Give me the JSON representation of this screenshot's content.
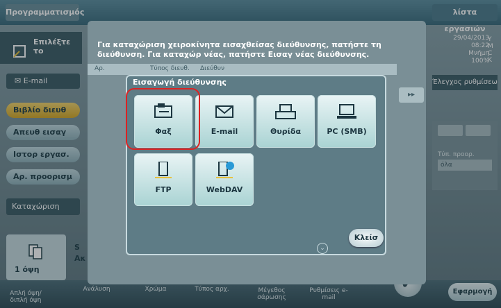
{
  "header": {
    "programs_tab": "Προγραμματισμός",
    "job_list_tab": "λίστα εργασιών"
  },
  "left": {
    "instruction_partial": "Επιλέξτε το",
    "email_tab": "E-mail",
    "buttons": [
      "Βιβλίο διευθ",
      "Απευθ εισαγ",
      "Ιστορ εργασ.",
      "Αρ. προορισμ"
    ],
    "register": "Καταχώριση"
  },
  "right": {
    "date": "29/04/2013",
    "time": "08:22",
    "memory_label": "Μνήμη",
    "memory_value": "100%",
    "toner": [
      "Y",
      "M",
      "C",
      "K"
    ],
    "check_settings": "Έλεγχος ρυθμίσεω",
    "dest_type_label": "Τύπ. προορ.",
    "dest_type_value": "όλα"
  },
  "instruction": {
    "text": "Για καταχώριση χειροκίνητα εισαχθείσας διεύθυνσης, πατήστε τη διεύθυνση. Για καταχώρ νέας, πατήστε Εισαγ νέας διεύθυνσης.",
    "col_no": "Αρ.",
    "col_type": "Τύπος διευθ.",
    "col_addr": "Διεύθυν"
  },
  "dialog": {
    "title": "Εισαγωγή διεύθυνσης",
    "options": [
      {
        "label": "Φαξ",
        "icon": "fax-icon"
      },
      {
        "label": "E-mail",
        "icon": "envelope-icon"
      },
      {
        "label": "Θυρίδα",
        "icon": "box-icon"
      },
      {
        "label": "PC (SMB)",
        "icon": "pc-icon"
      },
      {
        "label": "FTP",
        "icon": "ftp-server-icon"
      },
      {
        "label": "WebDAV",
        "icon": "webdav-icon"
      }
    ],
    "close": "Κλείσ"
  },
  "bottom": {
    "thumb_label": "1 όψη",
    "scan_partial": "S",
    "scan_partial2": "Ακ",
    "labels": [
      "Απλή όψη/ διπλή όψη",
      "Ανάλυση",
      "Χρώμα",
      "Τύπος αρχ.",
      "Μέγεθος σάρωσης",
      "Ρυθμίσεις e-mail"
    ],
    "apply": "Εφαρμογή"
  },
  "colors": {
    "highlight": "#dd2222",
    "selected_button": "#e8bd3f"
  }
}
